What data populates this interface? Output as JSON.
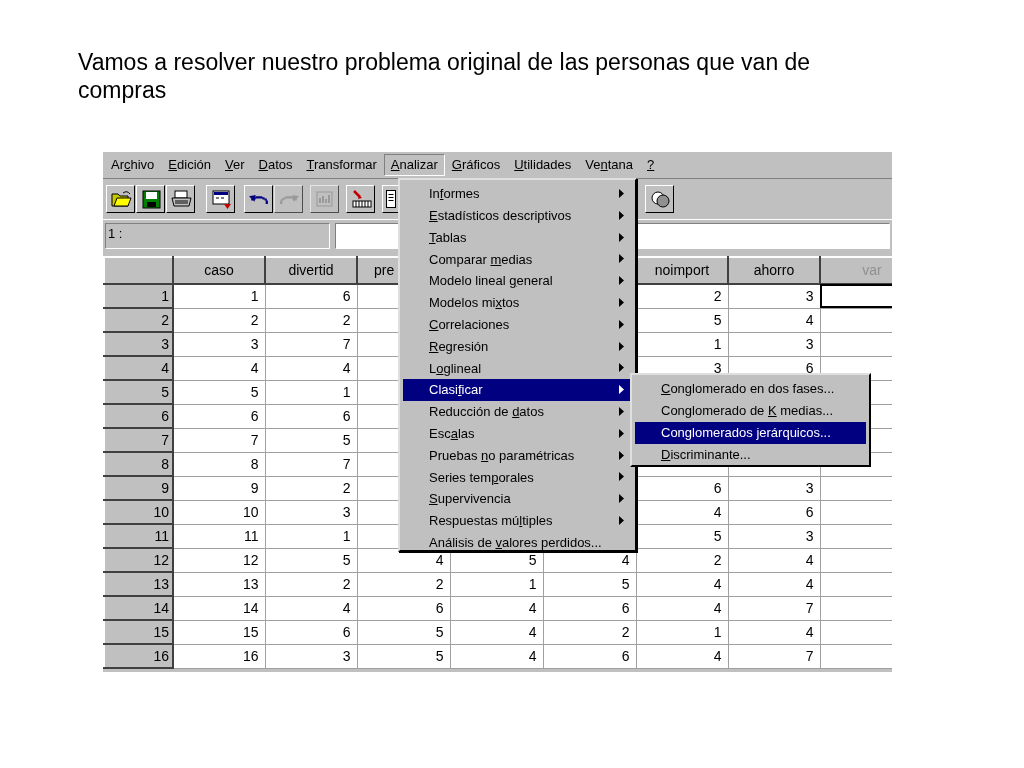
{
  "caption": "Vamos a resolver nuestro problema original de las personas que van de compras",
  "menubar": [
    {
      "before": "Ar",
      "key": "c",
      "after": "hivo",
      "selected": false
    },
    {
      "key": "E",
      "after": "dición",
      "selected": false
    },
    {
      "key": "V",
      "after": "er",
      "selected": false
    },
    {
      "key": "D",
      "after": "atos",
      "selected": false
    },
    {
      "key": "T",
      "after": "ransformar",
      "selected": false
    },
    {
      "key": "A",
      "after": "nalizar",
      "selected": true
    },
    {
      "key": "G",
      "after": "ráficos",
      "selected": false
    },
    {
      "key": "U",
      "after": "tilidades",
      "selected": false
    },
    {
      "before": "Ve",
      "key": "n",
      "after": "tana",
      "selected": false
    },
    {
      "key": "?",
      "selected": false
    }
  ],
  "toolbar": [
    {
      "kind": "open",
      "disabled": false
    },
    {
      "kind": "save",
      "disabled": false
    },
    {
      "kind": "print",
      "disabled": false
    },
    {
      "kind": "dialog",
      "disabled": false
    },
    {
      "kind": "undo",
      "disabled": false
    },
    {
      "kind": "redo",
      "disabled": true
    },
    {
      "kind": "chart",
      "disabled": true
    },
    {
      "kind": "goto",
      "disabled": false
    },
    {
      "kind": "variables",
      "disabled": false
    },
    {
      "kind": "sets",
      "disabled": false
    }
  ],
  "cell_editor": {
    "label": "1 :"
  },
  "table": {
    "columns": [
      {
        "label": "caso",
        "dimmed": false,
        "truncated": false
      },
      {
        "label": "divertid",
        "dimmed": false,
        "truncated": false
      },
      {
        "label": "pre",
        "dimmed": false,
        "truncated": true
      },
      null,
      null,
      {
        "label": "noimport",
        "dimmed": false,
        "truncated": false
      },
      {
        "label": "ahorro",
        "dimmed": false,
        "truncated": false
      },
      {
        "label": "var",
        "dimmed": true,
        "truncated": false
      }
    ],
    "rows": [
      {
        "label": "1",
        "active": true,
        "cells": [
          "1",
          "6",
          null,
          null,
          null,
          "2",
          "3",
          null
        ]
      },
      {
        "label": "2",
        "active": false,
        "cells": [
          "2",
          "2",
          null,
          null,
          null,
          "5",
          "4",
          null
        ]
      },
      {
        "label": "3",
        "active": false,
        "cells": [
          "3",
          "7",
          null,
          null,
          null,
          "1",
          "3",
          null
        ]
      },
      {
        "label": "4",
        "active": false,
        "cells": [
          "4",
          "4",
          null,
          null,
          null,
          "3",
          "6",
          null
        ]
      },
      {
        "label": "5",
        "active": false,
        "cells": [
          "5",
          "1",
          null,
          null,
          null,
          null,
          null,
          null
        ]
      },
      {
        "label": "6",
        "active": false,
        "cells": [
          "6",
          "6",
          null,
          null,
          null,
          null,
          null,
          null
        ]
      },
      {
        "label": "7",
        "active": false,
        "cells": [
          "7",
          "5",
          null,
          null,
          null,
          null,
          null,
          null
        ]
      },
      {
        "label": "8",
        "active": false,
        "cells": [
          "8",
          "7",
          null,
          null,
          null,
          null,
          null,
          null
        ]
      },
      {
        "label": "9",
        "active": false,
        "cells": [
          "9",
          "2",
          null,
          null,
          null,
          "6",
          "3",
          null
        ]
      },
      {
        "label": "10",
        "active": false,
        "cells": [
          "10",
          "3",
          null,
          null,
          null,
          "4",
          "6",
          null
        ]
      },
      {
        "label": "11",
        "active": false,
        "cells": [
          "11",
          "1",
          null,
          null,
          null,
          "5",
          "3",
          null
        ]
      },
      {
        "label": "12",
        "active": false,
        "cells": [
          "12",
          "5",
          "4",
          "5",
          "4",
          "2",
          "4",
          null
        ]
      },
      {
        "label": "13",
        "active": false,
        "cells": [
          "13",
          "2",
          "2",
          "1",
          "5",
          "4",
          "4",
          null
        ]
      },
      {
        "label": "14",
        "active": false,
        "cells": [
          "14",
          "4",
          "6",
          "4",
          "6",
          "4",
          "7",
          null
        ]
      },
      {
        "label": "15",
        "active": false,
        "cells": [
          "15",
          "6",
          "5",
          "4",
          "2",
          "1",
          "4",
          null
        ]
      },
      {
        "label": "16",
        "active": false,
        "cells": [
          "16",
          "3",
          "5",
          "4",
          "6",
          "4",
          "7",
          null
        ]
      }
    ]
  },
  "analizar_menu": [
    {
      "before": "In",
      "key": "f",
      "after": "ormes",
      "submenu": true,
      "selected": false
    },
    {
      "key": "E",
      "after": "stadísticos descriptivos",
      "submenu": true,
      "selected": false
    },
    {
      "key": "T",
      "after": "ablas",
      "submenu": true,
      "selected": false
    },
    {
      "before": "Comparar ",
      "key": "m",
      "after": "edias",
      "submenu": true,
      "selected": false
    },
    {
      "before": "Modelo lineal ",
      "key": "g",
      "after": "eneral",
      "submenu": true,
      "selected": false
    },
    {
      "before": "Modelos mi",
      "key": "x",
      "after": "tos",
      "submenu": true,
      "selected": false
    },
    {
      "key": "C",
      "after": "orrelaciones",
      "submenu": true,
      "selected": false
    },
    {
      "key": "R",
      "after": "egresión",
      "submenu": true,
      "selected": false
    },
    {
      "before": "L",
      "key": "o",
      "after": "glineal",
      "submenu": true,
      "selected": false
    },
    {
      "before": "Clasi",
      "key": "f",
      "after": "icar",
      "submenu": true,
      "selected": true
    },
    {
      "before": "Reducción de ",
      "key": "d",
      "after": "atos",
      "submenu": true,
      "selected": false
    },
    {
      "before": "Esc",
      "key": "a",
      "after": "las",
      "submenu": true,
      "selected": false
    },
    {
      "before": "Pruebas ",
      "key": "n",
      "after": "o paramétricas",
      "submenu": true,
      "selected": false
    },
    {
      "before": "Series tem",
      "key": "p",
      "after": "orales",
      "submenu": true,
      "selected": false
    },
    {
      "key": "S",
      "after": "upervivencia",
      "submenu": true,
      "selected": false
    },
    {
      "before": "Respuestas mú",
      "key": "l",
      "after": "tiples",
      "submenu": true,
      "selected": false
    },
    {
      "before": "Análisis de ",
      "key": "v",
      "after": "alores perdidos...",
      "submenu": false,
      "selected": false
    }
  ],
  "clasificar_submenu": [
    {
      "key": "C",
      "after": "onglomerado en dos fases...",
      "selected": false
    },
    {
      "before": "Conglomerado de ",
      "key": "K",
      "after": " medias...",
      "selected": false
    },
    {
      "before": "Con",
      "key": "g",
      "after": "lomerados jerárquicos...",
      "selected": true
    },
    {
      "key": "D",
      "after": "iscriminante...",
      "selected": false
    }
  ]
}
